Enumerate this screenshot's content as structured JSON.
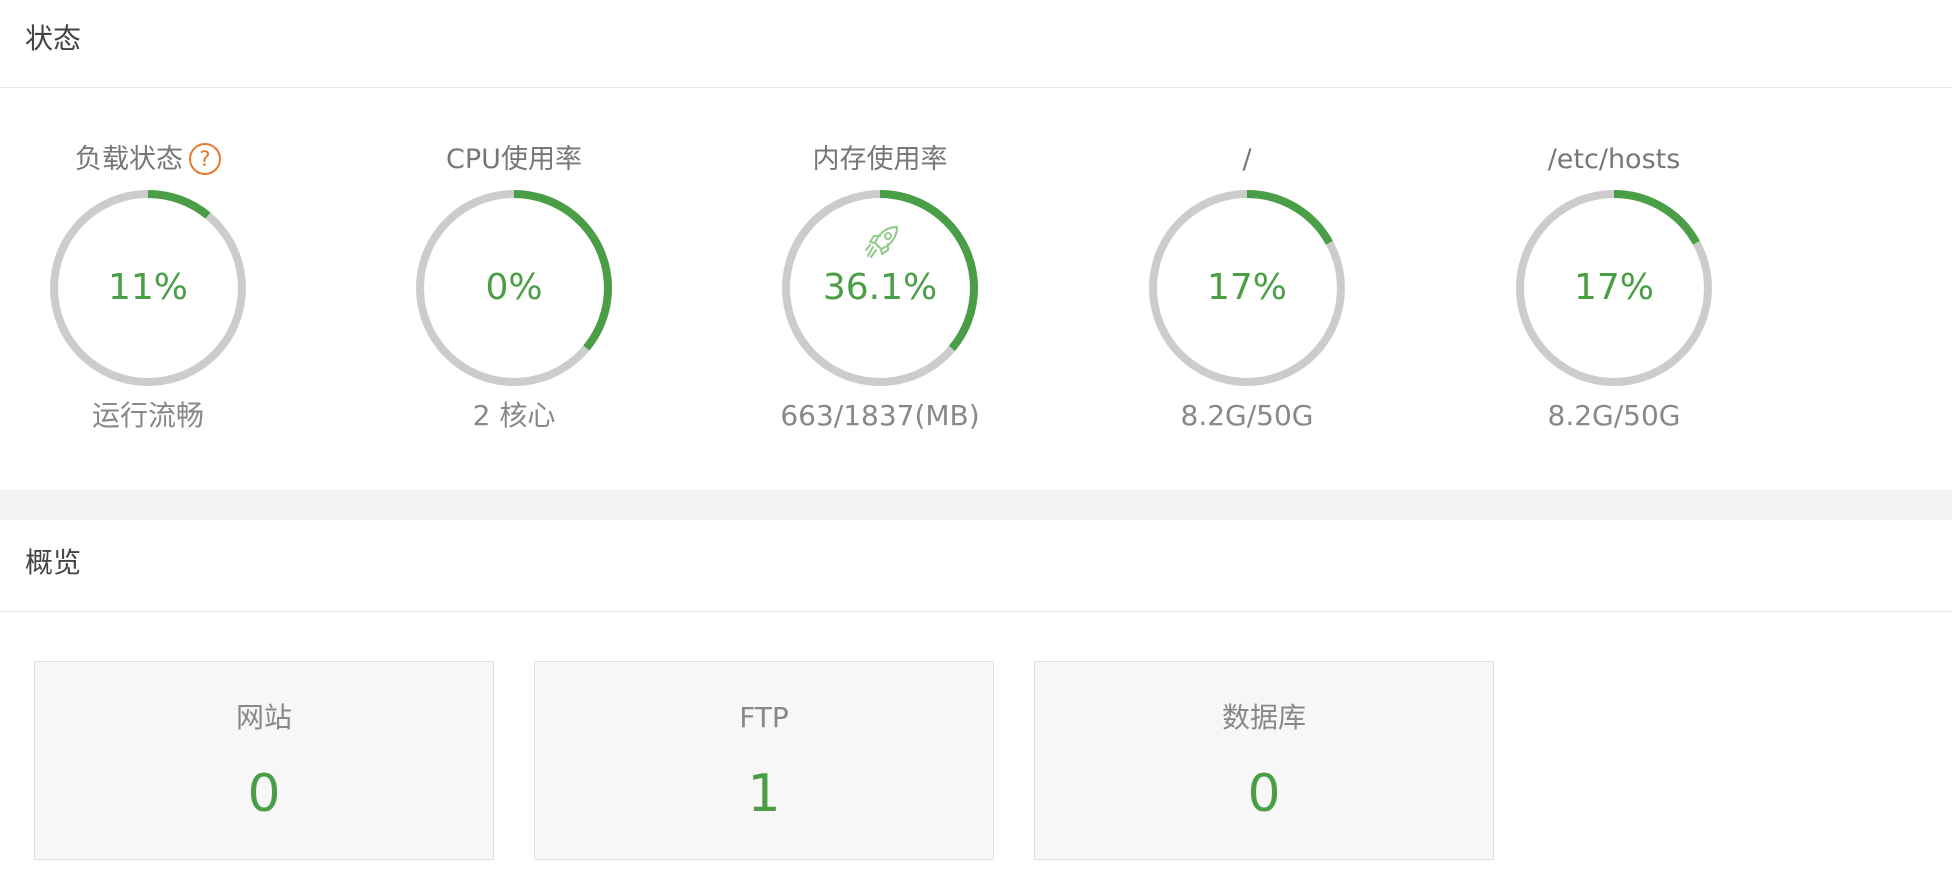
{
  "status": {
    "title": "状态",
    "colors": {
      "accent": "#4a9e45",
      "track": "#cccccc",
      "help": "#e8792c"
    },
    "gauges": [
      {
        "label": "负载状态",
        "has_help_icon": true,
        "help_icon": "?",
        "value": "11%",
        "percent": 11,
        "sub": "运行流畅"
      },
      {
        "label": "CPU使用率",
        "value": "0%",
        "percent": 0,
        "arc_shown_percent": 36,
        "sub": "2 核心"
      },
      {
        "label": "内存使用率",
        "value": "36.1%",
        "percent": 36.1,
        "icon": "rocket-icon",
        "sub": "663/1837(MB)"
      },
      {
        "label": "/",
        "value": "17%",
        "percent": 17,
        "sub": "8.2G/50G"
      },
      {
        "label": "/etc/hosts",
        "value": "17%",
        "percent": 17,
        "sub": "8.2G/50G"
      }
    ]
  },
  "overview": {
    "title": "概览",
    "cards": [
      {
        "label": "网站",
        "value": "0"
      },
      {
        "label": "FTP",
        "value": "1"
      },
      {
        "label": "数据库",
        "value": "0"
      }
    ]
  }
}
